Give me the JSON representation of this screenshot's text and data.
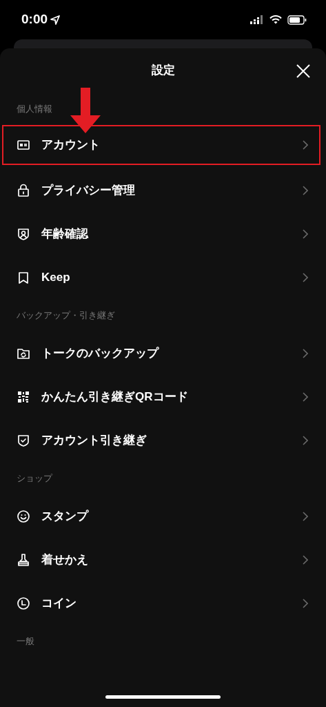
{
  "status_bar": {
    "time": "0:00"
  },
  "header": {
    "title": "設定"
  },
  "sections": [
    {
      "label": "個人情報",
      "items": [
        {
          "label": "アカウント",
          "highlighted": true
        },
        {
          "label": "プライバシー管理",
          "highlighted": false
        },
        {
          "label": "年齢確認",
          "highlighted": false
        },
        {
          "label": "Keep",
          "highlighted": false
        }
      ]
    },
    {
      "label": "バックアップ・引き継ぎ",
      "items": [
        {
          "label": "トークのバックアップ",
          "highlighted": false
        },
        {
          "label": "かんたん引き継ぎQRコード",
          "highlighted": false
        },
        {
          "label": "アカウント引き継ぎ",
          "highlighted": false
        }
      ]
    },
    {
      "label": "ショップ",
      "items": [
        {
          "label": "スタンプ",
          "highlighted": false
        },
        {
          "label": "着せかえ",
          "highlighted": false
        },
        {
          "label": "コイン",
          "highlighted": false
        }
      ]
    },
    {
      "label": "一般"
    }
  ]
}
